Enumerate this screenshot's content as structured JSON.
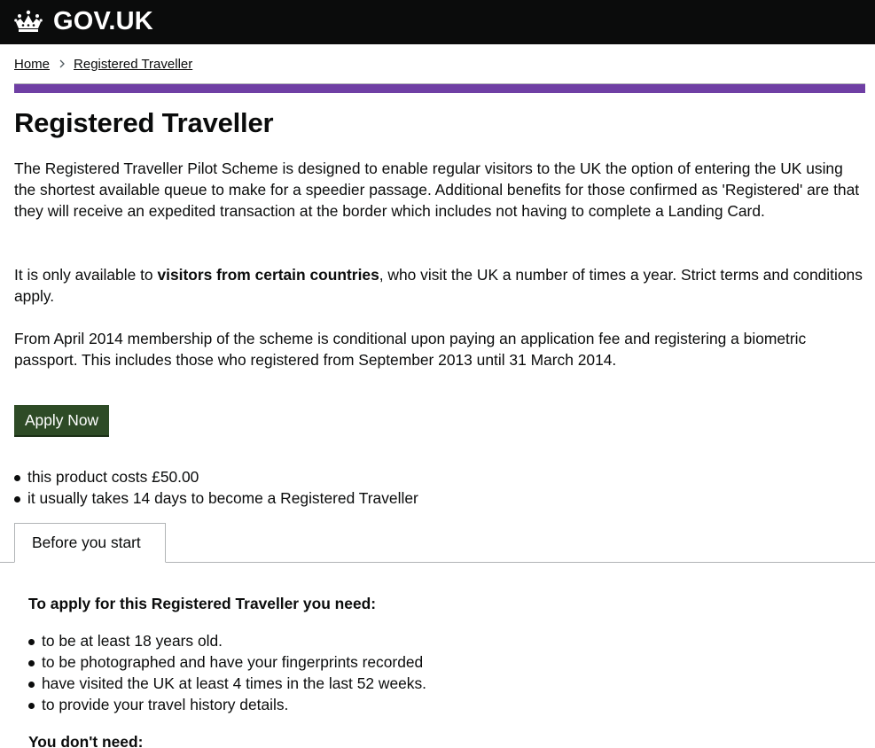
{
  "header": {
    "logo_text": "GOV.UK",
    "logo_icon": "crown-icon",
    "background": "#0b0c0c"
  },
  "breadcrumb": {
    "items": [
      "Home",
      "Registered Traveller"
    ]
  },
  "accent_color": "#6f3fa4",
  "page": {
    "title": "Registered Traveller",
    "para1": "The Registered Traveller Pilot Scheme is designed to enable regular visitors to the UK the option of entering the UK using the shortest available queue to make for a speedier passage. Additional benefits for those confirmed as 'Registered' are that they will receive an expedited transaction at the border which includes not having to complete a Landing Card.",
    "para2_before": "It is only available to ",
    "para2_bold": "visitors from certain countries",
    "para2_after": ", who visit the UK a number of times  a year. Strict terms and conditions apply.",
    "para3": "From April 2014 membership of the scheme is conditional upon paying an application fee and registering a biometric passport. This includes those who registered from September 2013 until 31 March 2014."
  },
  "apply_button": {
    "label": "Apply Now",
    "color": "#2e4b26"
  },
  "facts": [
    "this product costs £50.00",
    "it usually takes 14 days to become a Registered Traveller"
  ],
  "tabs": [
    {
      "label": "Before you start"
    }
  ],
  "before_you_start": {
    "need_heading": "To apply for this Registered Traveller you need:",
    "need_items": [
      "to be at least 18 years old.",
      "to be photographed and have your fingerprints recorded",
      "have visited the UK at least 4 times in the last 52 weeks.",
      "to provide your travel history details."
    ],
    "dont_need_heading": "You don't need:"
  }
}
